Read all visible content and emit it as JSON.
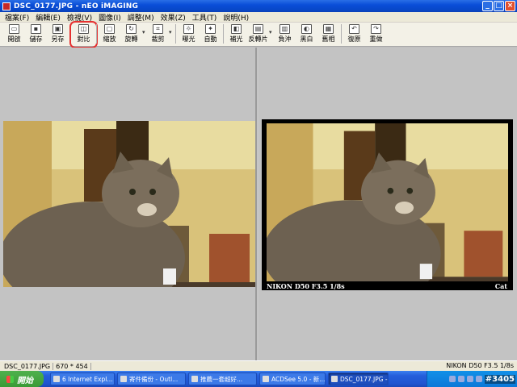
{
  "window": {
    "title": "DSC_0177.JPG - nEO iMAGING",
    "minimize": "_",
    "maximize": "□",
    "close": "×"
  },
  "menu": [
    "檔案(F)",
    "編輯(E)",
    "檢視(V)",
    "圖像(I)",
    "調整(M)",
    "效果(Z)",
    "工具(T)",
    "說明(H)"
  ],
  "toolbar": {
    "open": "開啟",
    "save": "儲存",
    "save_as": "另存",
    "compare": "對比",
    "zoom": "縮放",
    "rotate": "旋轉",
    "crop": "裁剪",
    "exposure": "曝光",
    "auto": "自動",
    "fill_light": "補光",
    "inverse_film": "反轉片",
    "negative": "負沖",
    "bw": "黑白",
    "old_photo": "舊相",
    "undo": "復原",
    "redo": "重做"
  },
  "preview": {
    "caption_left": "NIKON D50 F3.5 1/8s",
    "caption_right": "Cat"
  },
  "status": {
    "file": "DSC_0177.JPG",
    "size": "670 * 454",
    "right": "NIKON D50 F3.5 1/8s"
  },
  "taskbar": {
    "start": "開始",
    "tasks": [
      "6 Internet Expl...",
      "寄件備份 - Outl...",
      "推薦一套超好...",
      "ACDSee 5.0 - 新...",
      "DSC_0177.JPG -..."
    ],
    "watermark": "#3405"
  },
  "colors": {
    "title_bar": "#0a4ed8",
    "highlight": "#e53030",
    "start_green": "#3a9a36"
  }
}
